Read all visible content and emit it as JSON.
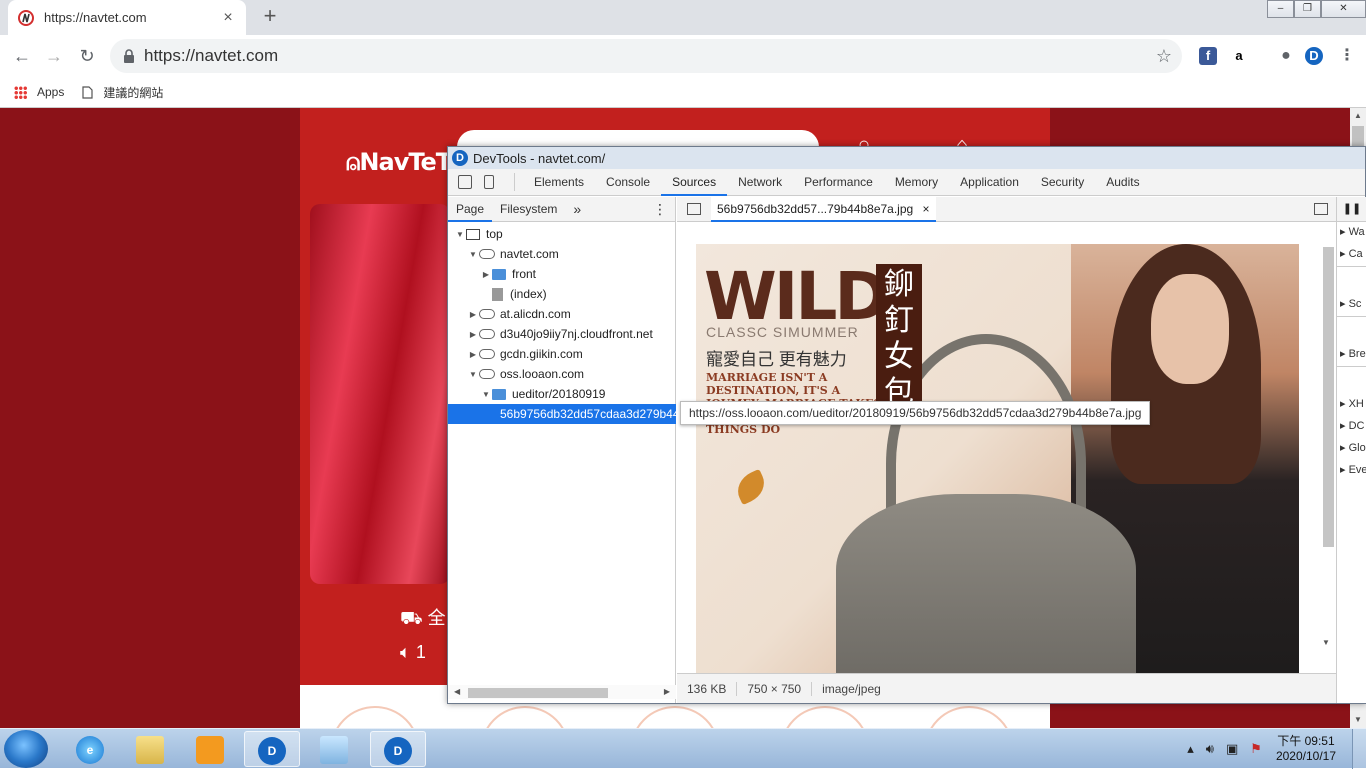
{
  "browser": {
    "tab_title": "https://navtet.com",
    "tab_close": "×",
    "new_tab": "+",
    "url": "https://navtet.com",
    "win_buttons": [
      "–",
      "❐",
      "✕"
    ],
    "bookmarks": [
      {
        "label": "Apps",
        "icon": "apps-grid-icon"
      },
      {
        "label": "建議的網站",
        "icon": "page-icon"
      }
    ],
    "extensions": [
      {
        "name": "facebook-icon",
        "glyph": "f",
        "color": "#3b5998"
      },
      {
        "name": "amazon-icon",
        "glyph": "a",
        "color": "#000000"
      },
      {
        "name": "profile-icon",
        "glyph": "●",
        "color": "#5f6368"
      },
      {
        "name": "devtools-ext-icon",
        "glyph": "D",
        "color": "#1565c0"
      }
    ]
  },
  "website": {
    "logo": "NavTeT",
    "service_lines": [
      "全",
      "1"
    ]
  },
  "devtools": {
    "title": "DevTools - navtet.com/",
    "tabs": [
      "Elements",
      "Console",
      "Sources",
      "Network",
      "Performance",
      "Memory",
      "Application",
      "Security",
      "Audits"
    ],
    "active_tab": "Sources",
    "navigator_tabs": [
      "Page",
      "Filesystem"
    ],
    "navigator_more": "»",
    "navigator_menu": "⋮",
    "tree": [
      {
        "label": "top",
        "depth": 0,
        "kind": "frame",
        "expanded": true
      },
      {
        "label": "navtet.com",
        "depth": 1,
        "kind": "cloud",
        "expanded": true
      },
      {
        "label": "front",
        "depth": 2,
        "kind": "folder",
        "expanded": false
      },
      {
        "label": "(index)",
        "depth": 2,
        "kind": "file",
        "expanded": null
      },
      {
        "label": "at.alicdn.com",
        "depth": 1,
        "kind": "cloud",
        "expanded": false
      },
      {
        "label": "d3u40jo9iiy7nj.cloudfront.net",
        "depth": 1,
        "kind": "cloud",
        "expanded": false
      },
      {
        "label": "gcdn.giikin.com",
        "depth": 1,
        "kind": "cloud",
        "expanded": false
      },
      {
        "label": "oss.looaon.com",
        "depth": 1,
        "kind": "cloud",
        "expanded": true
      },
      {
        "label": "ueditor/20180919",
        "depth": 2,
        "kind": "folder",
        "expanded": true
      },
      {
        "label": "56b9756db32dd57cdaa3d279b44b8e7a.jpg",
        "depth": 3,
        "kind": "file",
        "expanded": null,
        "selected": true
      }
    ],
    "open_file": "56b9756db32dd57...79b44b8e7a.jpg",
    "open_file_close": "×",
    "tooltip": "https://oss.looaon.com/ueditor/20180919/56b9756db32dd57cdaa3d279b44b8e7a.jpg",
    "status": {
      "size": "136 KB",
      "dimensions": "750 × 750",
      "mime": "image/jpeg"
    },
    "side_pane": [
      "Wa",
      "Ca",
      "Sc",
      "Bre",
      "XH",
      "DC",
      "Glo",
      "Eve"
    ],
    "pause_glyph": "❚❚"
  },
  "preview_image": {
    "headline": "WILD",
    "subtitle": "CLASSC SIMUMMER",
    "zh_line": "寵愛自己 更有魅力",
    "en_text": "MARRIAGE ISN'T A DESTINATION, IT'S A JOUMEY. MARRIAGE TAKES COMMITMENT, ALL GOOD THINGS DO",
    "vertical_zh": "鉚釘女包"
  },
  "taskbar": {
    "clock_time": "下午 09:51",
    "clock_date": "2020/10/17"
  }
}
